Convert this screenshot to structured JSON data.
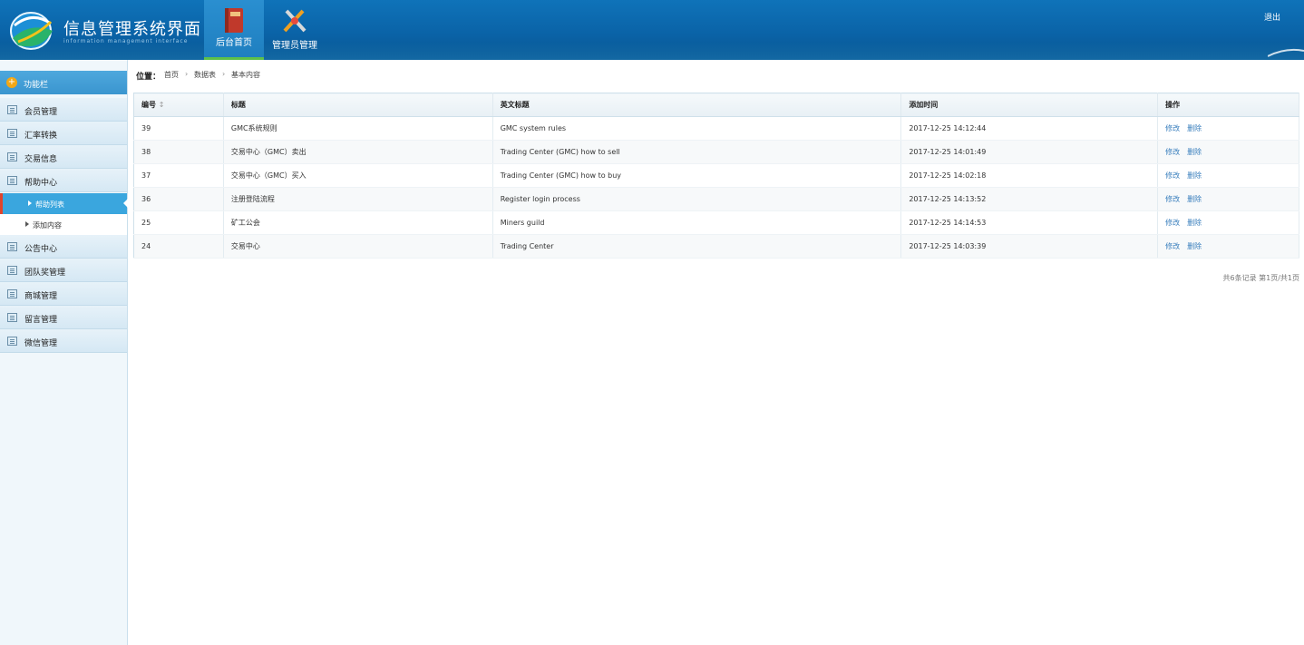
{
  "header": {
    "title": "信息管理系统界面",
    "subtitle": "information management interface",
    "logout": "退出",
    "nav": [
      {
        "label": "后台首页",
        "active": true
      },
      {
        "label": "管理员管理",
        "active": false
      }
    ]
  },
  "sidebar": {
    "head": "功能栏",
    "menus": [
      {
        "label": "会员管理"
      },
      {
        "label": "汇率转换"
      },
      {
        "label": "交易信息"
      },
      {
        "label": "帮助中心"
      }
    ],
    "subs": [
      {
        "label": "帮助列表",
        "active": true
      },
      {
        "label": "添加内容",
        "active": false
      }
    ],
    "menus2": [
      {
        "label": "公告中心"
      },
      {
        "label": "团队奖管理"
      },
      {
        "label": "商城管理"
      },
      {
        "label": "留言管理"
      },
      {
        "label": "微信管理"
      }
    ]
  },
  "breadcrumb": {
    "label": "位置：",
    "items": [
      "首页",
      "数据表",
      "基本内容"
    ],
    "sep": "›"
  },
  "table": {
    "headers": [
      "编号",
      "标题",
      "英文标题",
      "添加时间",
      "操作"
    ],
    "sort_mark": "↕",
    "edit_label": "修改",
    "delete_label": "删除",
    "rows": [
      {
        "id": "39",
        "title": "GMC系统规则",
        "en_title": "GMC system rules",
        "time": "2017-12-25 14:12:44"
      },
      {
        "id": "38",
        "title": "交易中心（GMC）卖出",
        "en_title": "Trading Center (GMC)  how to sell",
        "time": "2017-12-25 14:01:49"
      },
      {
        "id": "37",
        "title": "交易中心（GMC）买入",
        "en_title": "Trading Center (GMC) how to buy",
        "time": "2017-12-25 14:02:18"
      },
      {
        "id": "36",
        "title": "注册登陆流程",
        "en_title": "Register login process",
        "time": "2017-12-25 14:13:52"
      },
      {
        "id": "25",
        "title": "矿工公会",
        "en_title": "Miners guild",
        "time": "2017-12-25 14:14:53"
      },
      {
        "id": "24",
        "title": "交易中心",
        "en_title": "Trading Center",
        "time": "2017-12-25 14:03:39"
      }
    ]
  },
  "pager": "共6条记录 第1页/共1页"
}
